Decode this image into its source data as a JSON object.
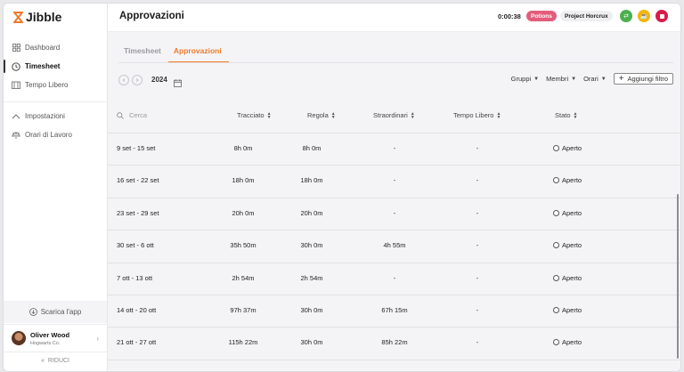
{
  "sidebar": {
    "logo": "Jibble",
    "items": [
      {
        "label": "Dashboard",
        "icon": "dashboard-icon"
      },
      {
        "label": "Timesheet",
        "icon": "clock-icon",
        "active": true
      },
      {
        "label": "Tempo Libero",
        "icon": "calendar-icon"
      }
    ],
    "items2": [
      {
        "label": "Impostazioni",
        "icon": "chevron-up-icon"
      },
      {
        "label": "Orari di Lavoro",
        "icon": "scale-icon"
      }
    ],
    "download": "Scarica l'app",
    "user": {
      "name": "Oliver Wood",
      "org": "Hogwarts Co."
    },
    "collapse": "RIDUCI"
  },
  "header": {
    "title": "Approvazioni",
    "timer": "0:00:38",
    "activity": "Potions",
    "project": "Project Horcrux",
    "colors": {
      "potions": "#e35d7b",
      "green": "#4caf50",
      "yellow": "#f5b400",
      "red": "#d81b4a"
    }
  },
  "tabs": [
    {
      "label": "Timesheet",
      "active": false
    },
    {
      "label": "Approvazioni",
      "active": true
    }
  ],
  "toolbar": {
    "year": "2024",
    "filters": [
      "Gruppi",
      "Membri",
      "Orari"
    ],
    "add_filter": "Aggiungi filtro"
  },
  "table": {
    "search_placeholder": "Cerca",
    "columns": [
      "Tracciato",
      "Regola",
      "Straordinari",
      "Tempo Libero",
      "Stato"
    ],
    "rows": [
      {
        "week": "9 set - 15 set",
        "tracked": "8h 0m",
        "regular": "8h 0m",
        "overtime": "-",
        "timeoff": "-",
        "status": "Aperto"
      },
      {
        "week": "16 set - 22 set",
        "tracked": "18h 0m",
        "regular": "18h 0m",
        "overtime": "-",
        "timeoff": "-",
        "status": "Aperto"
      },
      {
        "week": "23 set - 29 set",
        "tracked": "20h 0m",
        "regular": "20h 0m",
        "overtime": "-",
        "timeoff": "-",
        "status": "Aperto"
      },
      {
        "week": "30 set - 6 ott",
        "tracked": "35h 50m",
        "regular": "30h 0m",
        "overtime": "4h 55m",
        "timeoff": "-",
        "status": "Aperto"
      },
      {
        "week": "7 ott - 13 ott",
        "tracked": "2h 54m",
        "regular": "2h 54m",
        "overtime": "-",
        "timeoff": "-",
        "status": "Aperto"
      },
      {
        "week": "14 ott - 20 ott",
        "tracked": "97h 37m",
        "regular": "30h 0m",
        "overtime": "67h 15m",
        "timeoff": "-",
        "status": "Aperto"
      },
      {
        "week": "21 ott - 27 ott",
        "tracked": "115h 22m",
        "regular": "30h 0m",
        "overtime": "85h 22m",
        "timeoff": "-",
        "status": "Aperto"
      }
    ]
  }
}
